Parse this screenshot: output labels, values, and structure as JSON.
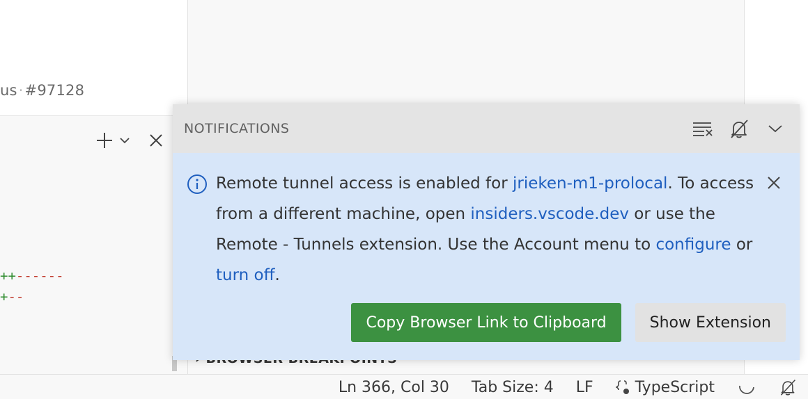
{
  "left_pane": {
    "issue_ref_prefix": "us",
    "issue_ref_number": "#97128",
    "diff_lines": [
      {
        "plus": "++",
        "minus": "------"
      },
      {
        "plus": "+",
        "minus": "--"
      }
    ]
  },
  "right_pane": {
    "breakpoints_label": "BROWSER BREAKPOINTS"
  },
  "notifications": {
    "title": "NOTIFICATIONS",
    "message": {
      "part1": "Remote tunnel access is enabled for ",
      "link_machine": "jrieken-m1-prolocal",
      "part2": ". To access from a different machine, open ",
      "link_insiders": "insiders.vscode.dev",
      "part3": " or use the Remote - Tunnels extension. Use the Account menu to ",
      "link_configure": "configure",
      "part4": " or ",
      "link_turn_off": "turn off",
      "part5": "."
    },
    "primary_button": "Copy Browser Link to Clipboard",
    "secondary_button": "Show Extension"
  },
  "statusbar": {
    "position": "Ln 366, Col 30",
    "tab_size": "Tab Size: 4",
    "eol": "LF",
    "language": "TypeScript"
  },
  "colors": {
    "link": "#1f5fbf",
    "primary_button": "#3c9141",
    "notification_bg": "#d7e6f9",
    "diff_plus": "#2e8b2e",
    "diff_minus": "#c0392b"
  }
}
